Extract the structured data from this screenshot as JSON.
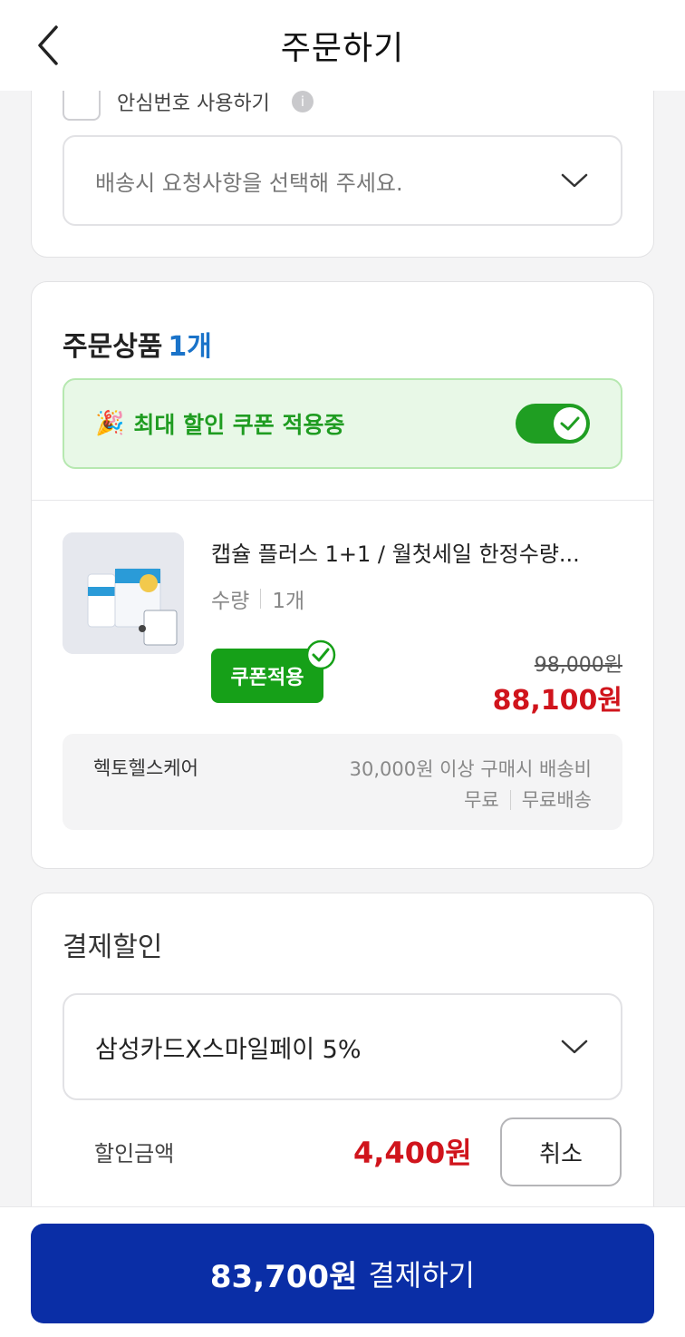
{
  "header": {
    "title": "주문하기"
  },
  "delivery": {
    "safe_number_label": "안심번호 사용하기",
    "request_placeholder": "배송시 요청사항을 선택해 주세요."
  },
  "order_items": {
    "title": "주문상품",
    "count": "1개",
    "coupon_banner": "최대 할인 쿠폰 적용중",
    "coupon_toggle_on": true,
    "product": {
      "name": "캡슐 플러스 1+1 / 월첫세일 한정수량...",
      "qty_label": "수량",
      "qty_value": "1개",
      "coupon_button": "쿠폰적용",
      "price_original": "98,000원",
      "price_final": "88,100원"
    },
    "seller": {
      "name": "헥토헬스케어",
      "shipping_line1": "30,000원 이상 구매시 배송비",
      "shipping_free": "무료",
      "shipping_type": "무료배송"
    }
  },
  "payment_discount": {
    "title": "결제할인",
    "selected_card": "삼성카드X스마일페이 5%",
    "discount_label": "할인금액",
    "discount_amount": "4,400원",
    "cancel_label": "취소"
  },
  "bottom": {
    "pay_amount": "83,700원",
    "pay_label": "결제하기"
  },
  "colors": {
    "accent_blue": "#1a73c9",
    "pay_button": "#0a2ea6",
    "coupon_green": "#16a018",
    "price_red": "#d0141c"
  }
}
